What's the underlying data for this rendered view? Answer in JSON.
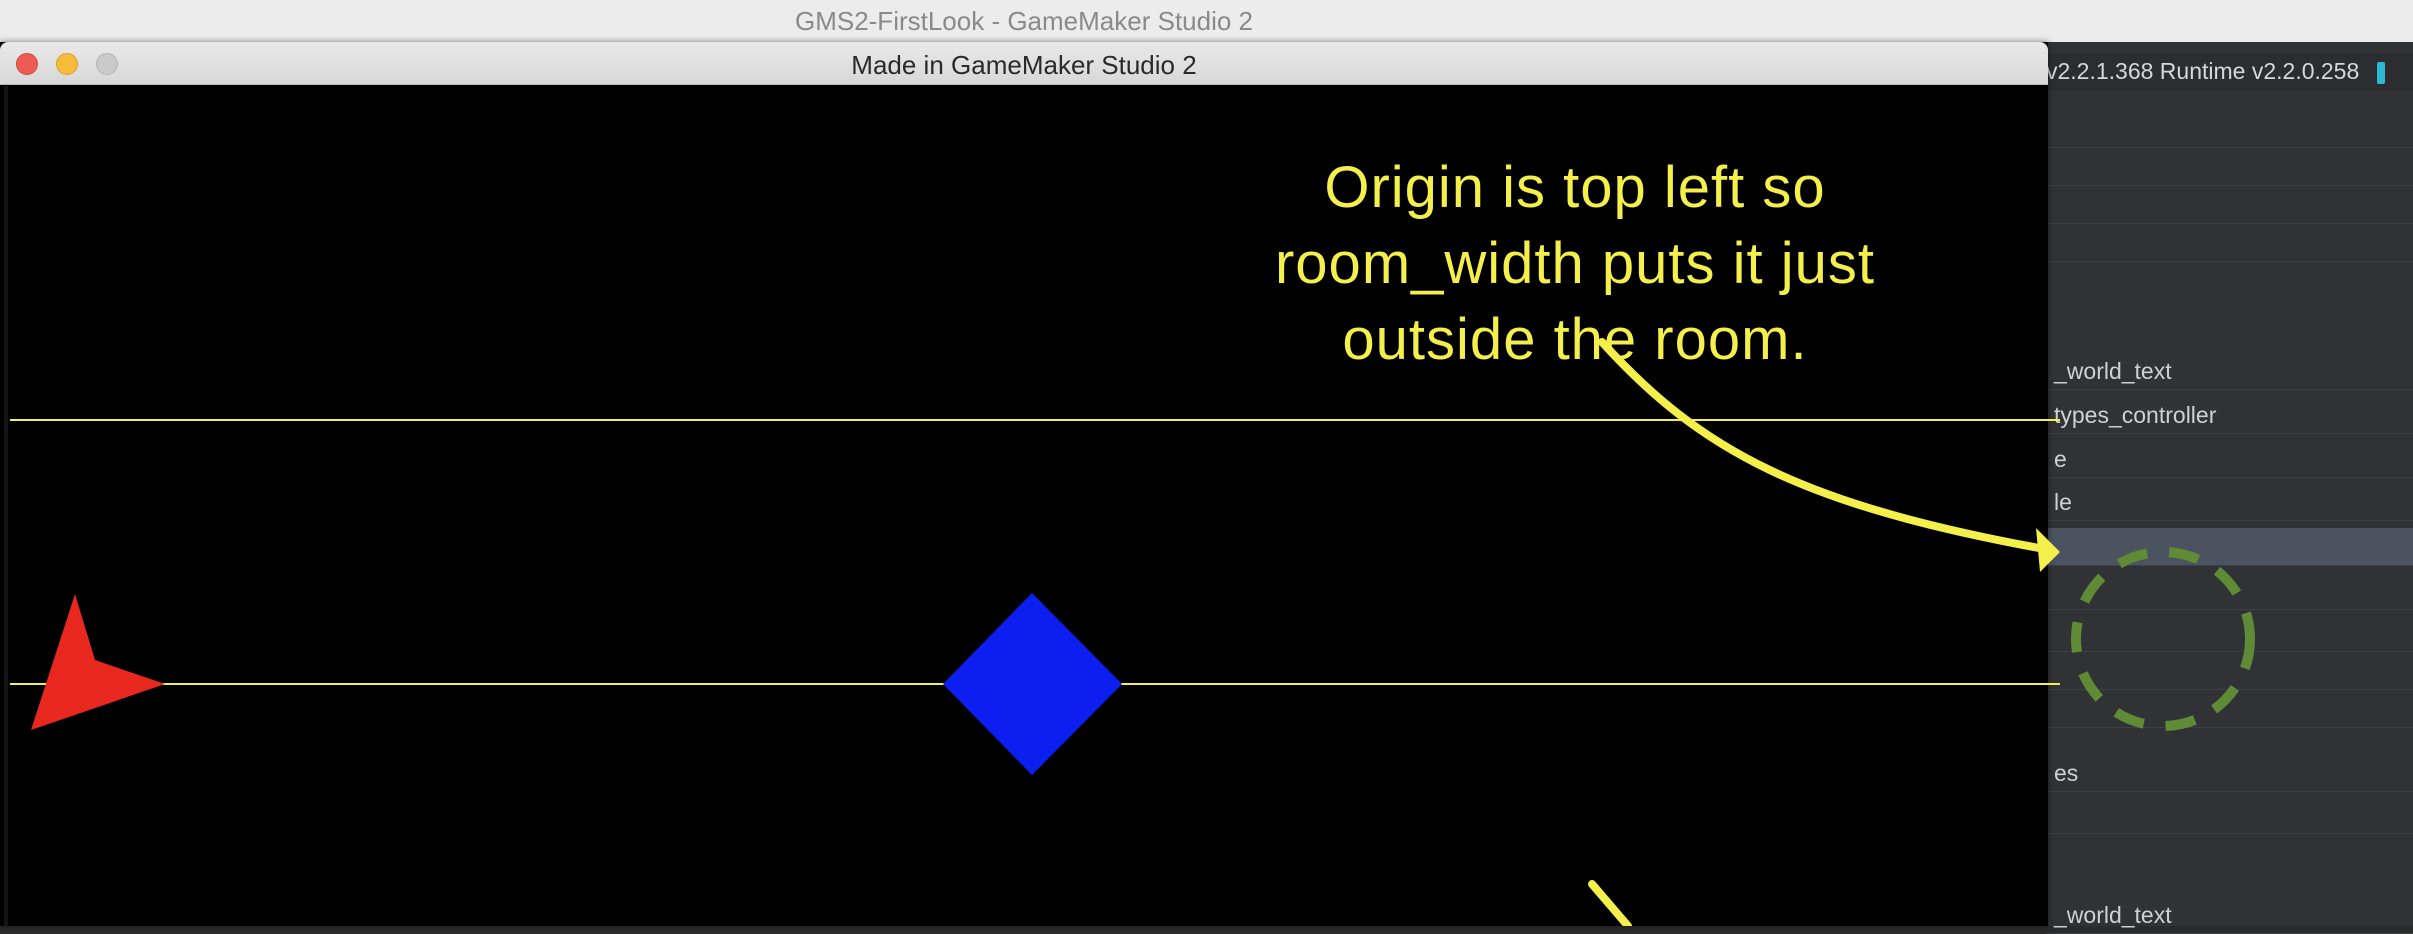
{
  "ide": {
    "title": "GMS2-FirstLook - GameMaker Studio 2",
    "version_text": "v2.2.1.368  Runtime v2.2.0.258",
    "panel_rows": [
      {
        "label": ""
      },
      {
        "label": ""
      },
      {
        "label": ""
      },
      {
        "label": ""
      },
      {
        "label": "_world_text"
      },
      {
        "label": "types_controller"
      },
      {
        "label": "e"
      },
      {
        "label": "le"
      },
      {
        "label": "",
        "selected": true
      },
      {
        "label": ""
      },
      {
        "label": ""
      },
      {
        "label": ""
      },
      {
        "label": ""
      },
      {
        "label": "es"
      },
      {
        "label": ""
      },
      {
        "label": "_world_text"
      }
    ]
  },
  "game_window": {
    "title": "Made in GameMaker Studio 2",
    "annotation": {
      "line1": "Origin is top left so",
      "line2": "room_width puts it just",
      "line3": "outside the room."
    },
    "colors": {
      "guide_line": "#f4ef4a",
      "player_arrow": "#e8271f",
      "diamond": "#0c1ef0",
      "target_circle": "#5f8a36"
    }
  }
}
